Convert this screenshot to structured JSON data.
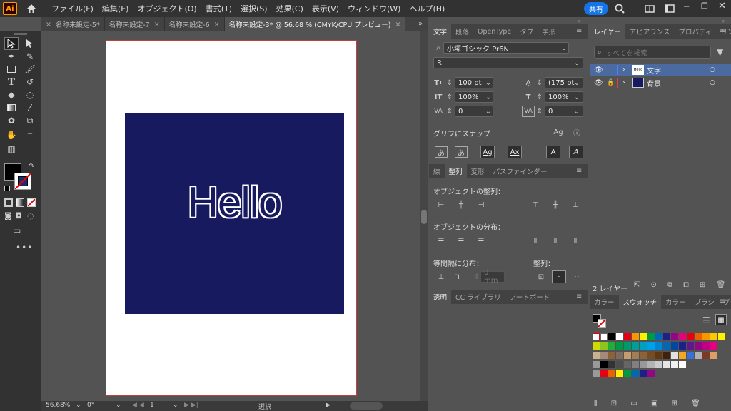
{
  "app": {
    "logo": "Ai",
    "share_label": "共有"
  },
  "menu": [
    "ファイル(F)",
    "編集(E)",
    "オブジェクト(O)",
    "書式(T)",
    "選択(S)",
    "効果(C)",
    "表示(V)",
    "ウィンドウ(W)",
    "ヘルプ(H)"
  ],
  "doc_tabs": [
    {
      "label": "名称未設定-5*"
    },
    {
      "label": "名称未設定-7"
    },
    {
      "label": "名称未設定-6"
    },
    {
      "label": "名称未設定-3* @ 56.68 % (CMYK/CPU プレビュー)"
    }
  ],
  "artwork": {
    "text": "Hello",
    "rect_color": "#171a5e"
  },
  "status": {
    "zoom": "56.68%",
    "rotation": "0°",
    "page": "1",
    "tool": "選択"
  },
  "char_panel": {
    "tabs": [
      "文字",
      "段落",
      "OpenType",
      "タブ",
      "字形"
    ],
    "font_family": "小塚ゴシック Pr6N",
    "font_style": "R",
    "size": "100 pt",
    "leading": "(175 pt",
    "vscale": "100%",
    "hscale": "100%",
    "kerning": "0",
    "tracking": "0",
    "snap_label": "グリフにスナップ"
  },
  "align_panel": {
    "tabs": [
      "線",
      "整列",
      "変形",
      "パスファインダー"
    ],
    "align_objects": "オブジェクトの整列：",
    "distribute_objects": "オブジェクトの分布：",
    "distribute_spacing": "等間隔に分布：",
    "align_to": "整列：",
    "spacing_value": "0 mm"
  },
  "transparency_tabs": [
    "透明",
    "CC ライブラリ",
    "アートボード"
  ],
  "layers_panel": {
    "tabs": [
      "レイヤー",
      "アピアランス",
      "プロパティ",
      "リンク"
    ],
    "search_placeholder": "すべてを検索",
    "layers": [
      {
        "name": "文字",
        "color": "#4f7fff",
        "thumb": "Hello"
      },
      {
        "name": "背景",
        "color": "#e04040"
      }
    ],
    "count": "2 レイヤー"
  },
  "swatch_panel": {
    "tabs": [
      "カラー",
      "スウォッチ",
      "カラー",
      "ブラシ",
      "グラデ"
    ],
    "row1": [
      "#000000",
      "#ffffff",
      "#e60012",
      "#f39800",
      "#fff100",
      "#009944",
      "#0068b7",
      "#1d2088",
      "#920783",
      "#e4007f",
      "#e60012",
      "#eb6100",
      "#f39800",
      "#fcc800",
      "#fff100"
    ],
    "row2": [
      "#cfdb00",
      "#8fc31f",
      "#22ac38",
      "#009944",
      "#009b6b",
      "#009e96",
      "#00a0c1",
      "#00a0e9",
      "#0086d1",
      "#0068b7",
      "#00479d",
      "#1d2088",
      "#601986",
      "#920783",
      "#be0081",
      "#e4007f"
    ],
    "row3": [
      "#c9b28f",
      "#a48b78",
      "#8c6239",
      "#7d6b5d",
      "#c69c6d",
      "#a67c52",
      "#8c6239",
      "#754c24",
      "#603913",
      "#42210b",
      "#e0e0e0",
      "#f5a623",
      "#3a6fd8",
      "#b0b0b0",
      "#7a3a2a",
      "#d9a066"
    ],
    "row4": [
      "#000000",
      "#333333",
      "#4d4d4d",
      "#666666",
      "#808080",
      "#999999",
      "#b3b3b3",
      "#cccccc",
      "#e6e6e6",
      "#f2f2f2",
      "#ffffff"
    ],
    "row5": [
      "#e60012",
      "#eb6100",
      "#fff100",
      "#009944",
      "#0068b7",
      "#1d2088",
      "#920783"
    ]
  }
}
